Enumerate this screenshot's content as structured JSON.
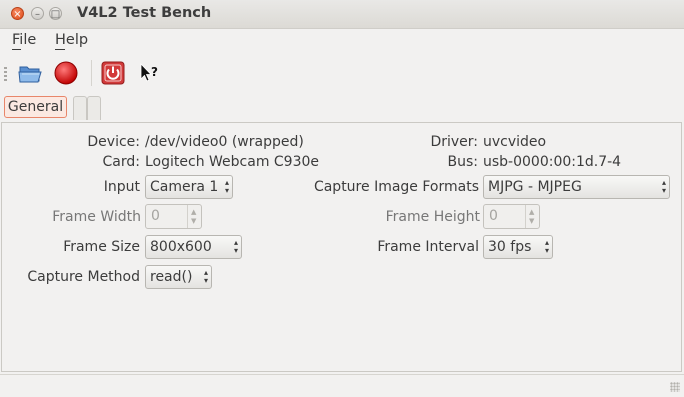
{
  "window": {
    "title": "V4L2 Test Bench"
  },
  "menu": {
    "file": "File",
    "help": "Help"
  },
  "toolbar": {
    "open_icon": "folder-open-icon",
    "record_icon": "record-icon",
    "power_icon": "power-icon",
    "whats_this_icon": "whats-this-icon"
  },
  "tabs": [
    {
      "label": "General"
    },
    {
      "label": ""
    },
    {
      "label": ""
    }
  ],
  "general": {
    "device_label": "Device:",
    "device_value": "/dev/video0 (wrapped)",
    "card_label": "Card:",
    "card_value": "Logitech Webcam C930e",
    "driver_label": "Driver:",
    "driver_value": "uvcvideo",
    "bus_label": "Bus:",
    "bus_value": "usb-0000:00:1d.7-4",
    "input_label": "Input",
    "input_value": "Camera 1",
    "capture_formats_label": "Capture Image Formats",
    "capture_formats_value": "MJPG - MJPEG",
    "frame_width_label": "Frame Width",
    "frame_width_value": "0",
    "frame_height_label": "Frame Height",
    "frame_height_value": "0",
    "frame_size_label": "Frame Size",
    "frame_size_value": "800x600",
    "frame_interval_label": "Frame Interval",
    "frame_interval_value": "30 fps",
    "capture_method_label": "Capture Method",
    "capture_method_value": "read()"
  },
  "colors": {
    "accent": "#e8866a",
    "record": "#d40000",
    "power": "#c8262b"
  }
}
